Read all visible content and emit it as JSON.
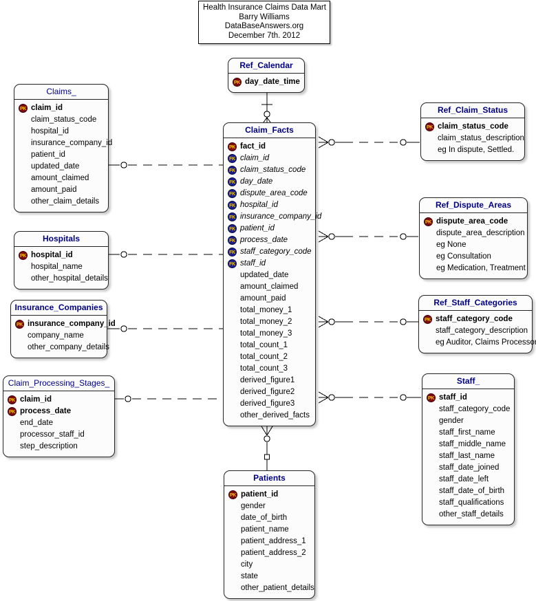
{
  "title_block": {
    "lines": [
      "Health Insurance Claims Data Mart",
      "Barry Williams",
      "DataBaseAnswers.org",
      "December 7th. 2012"
    ]
  },
  "colors": {
    "entity_title": "#000080",
    "pk_badge": "#7d0b10",
    "fk_badge": "#1b1f8c",
    "badge_text": "#f2c200",
    "entity_fill": "#fcfcfc",
    "entity_border": "#222222",
    "connector": "#000000"
  },
  "icon_labels": {
    "pk": "PK",
    "fk": "FK"
  },
  "entities": [
    {
      "id": "ref_calendar",
      "name": "Ref_Calendar",
      "title_bold": true,
      "columns": [
        {
          "name": "day_date_time",
          "key": "pk",
          "bold": true,
          "italic": false
        }
      ]
    },
    {
      "id": "claims",
      "name": "Claims_",
      "title_bold": false,
      "columns": [
        {
          "name": "claim_id",
          "key": "pk",
          "bold": true,
          "italic": false
        },
        {
          "name": "claim_status_code",
          "key": "none",
          "bold": false,
          "italic": false
        },
        {
          "name": "hospital_id",
          "key": "none",
          "bold": false,
          "italic": false
        },
        {
          "name": "insurance_company_id",
          "key": "none",
          "bold": false,
          "italic": false
        },
        {
          "name": "patient_id",
          "key": "none",
          "bold": false,
          "italic": false
        },
        {
          "name": "updated_date",
          "key": "none",
          "bold": false,
          "italic": false
        },
        {
          "name": "amount_claimed",
          "key": "none",
          "bold": false,
          "italic": false
        },
        {
          "name": "amount_paid",
          "key": "none",
          "bold": false,
          "italic": false
        },
        {
          "name": "other_claim_details",
          "key": "none",
          "bold": false,
          "italic": false
        }
      ]
    },
    {
      "id": "hospitals",
      "name": "Hospitals",
      "title_bold": true,
      "columns": [
        {
          "name": "hospital_id",
          "key": "pk",
          "bold": true,
          "italic": false
        },
        {
          "name": "hospital_name",
          "key": "none",
          "bold": false,
          "italic": false
        },
        {
          "name": "other_hospital_details",
          "key": "none",
          "bold": false,
          "italic": false
        }
      ]
    },
    {
      "id": "insurance_companies",
      "name": "Insurance_Companies",
      "title_bold": true,
      "columns": [
        {
          "name": "insurance_company_id",
          "key": "pk",
          "bold": true,
          "italic": false
        },
        {
          "name": "company_name",
          "key": "none",
          "bold": false,
          "italic": false
        },
        {
          "name": "other_company_details",
          "key": "none",
          "bold": false,
          "italic": false
        }
      ]
    },
    {
      "id": "claim_processing_stages",
      "name": "Claim_Processing_Stages_",
      "title_bold": false,
      "columns": [
        {
          "name": "claim_id",
          "key": "pk",
          "bold": true,
          "italic": false
        },
        {
          "name": "process_date",
          "key": "pk",
          "bold": true,
          "italic": false
        },
        {
          "name": "end_date",
          "key": "none",
          "bold": false,
          "italic": false
        },
        {
          "name": "processor_staff_id",
          "key": "none",
          "bold": false,
          "italic": false
        },
        {
          "name": "step_description",
          "key": "none",
          "bold": false,
          "italic": false
        }
      ]
    },
    {
      "id": "claim_facts",
      "name": "Claim_Facts",
      "title_bold": true,
      "columns": [
        {
          "name": "fact_id",
          "key": "pk",
          "bold": true,
          "italic": false
        },
        {
          "name": "claim_id",
          "key": "fk",
          "bold": false,
          "italic": true
        },
        {
          "name": "claim_status_code",
          "key": "fk",
          "bold": false,
          "italic": true
        },
        {
          "name": "day_date",
          "key": "fk",
          "bold": false,
          "italic": true
        },
        {
          "name": "dispute_area_code",
          "key": "fk",
          "bold": false,
          "italic": true
        },
        {
          "name": "hospital_id",
          "key": "fk",
          "bold": false,
          "italic": true
        },
        {
          "name": "insurance_company_id",
          "key": "fk",
          "bold": false,
          "italic": true
        },
        {
          "name": "patient_id",
          "key": "fk",
          "bold": false,
          "italic": true
        },
        {
          "name": "process_date",
          "key": "fk",
          "bold": false,
          "italic": true
        },
        {
          "name": "staff_category_code",
          "key": "fk",
          "bold": false,
          "italic": true
        },
        {
          "name": "staff_id",
          "key": "fk",
          "bold": false,
          "italic": true
        },
        {
          "name": "updated_date",
          "key": "none",
          "bold": false,
          "italic": false
        },
        {
          "name": "amount_claimed",
          "key": "none",
          "bold": false,
          "italic": false
        },
        {
          "name": "amount_paid",
          "key": "none",
          "bold": false,
          "italic": false
        },
        {
          "name": "total_money_1",
          "key": "none",
          "bold": false,
          "italic": false
        },
        {
          "name": "total_money_2",
          "key": "none",
          "bold": false,
          "italic": false
        },
        {
          "name": "total_money_3",
          "key": "none",
          "bold": false,
          "italic": false
        },
        {
          "name": "total_count_1",
          "key": "none",
          "bold": false,
          "italic": false
        },
        {
          "name": "total_count_2",
          "key": "none",
          "bold": false,
          "italic": false
        },
        {
          "name": "total_count_3",
          "key": "none",
          "bold": false,
          "italic": false
        },
        {
          "name": "derived_figure1",
          "key": "none",
          "bold": false,
          "italic": false
        },
        {
          "name": "derived_figure2",
          "key": "none",
          "bold": false,
          "italic": false
        },
        {
          "name": "derived_figure3",
          "key": "none",
          "bold": false,
          "italic": false
        },
        {
          "name": "other_derived_facts",
          "key": "none",
          "bold": false,
          "italic": false
        }
      ]
    },
    {
      "id": "patients",
      "name": "Patients",
      "title_bold": true,
      "columns": [
        {
          "name": "patient_id",
          "key": "pk",
          "bold": true,
          "italic": false
        },
        {
          "name": "gender",
          "key": "none",
          "bold": false,
          "italic": false
        },
        {
          "name": "date_of_birth",
          "key": "none",
          "bold": false,
          "italic": false
        },
        {
          "name": "patient_name",
          "key": "none",
          "bold": false,
          "italic": false
        },
        {
          "name": "patient_address_1",
          "key": "none",
          "bold": false,
          "italic": false
        },
        {
          "name": "patient_address_2",
          "key": "none",
          "bold": false,
          "italic": false
        },
        {
          "name": "city",
          "key": "none",
          "bold": false,
          "italic": false
        },
        {
          "name": "state",
          "key": "none",
          "bold": false,
          "italic": false
        },
        {
          "name": "other_patient_details",
          "key": "none",
          "bold": false,
          "italic": false
        }
      ]
    },
    {
      "id": "ref_claim_status",
      "name": "Ref_Claim_Status",
      "title_bold": true,
      "columns": [
        {
          "name": "claim_status_code",
          "key": "pk",
          "bold": true,
          "italic": false
        },
        {
          "name": "claim_status_description",
          "key": "none",
          "bold": false,
          "italic": false
        },
        {
          "name": "eg In dispute, Settled.",
          "key": "none",
          "bold": false,
          "italic": false
        }
      ]
    },
    {
      "id": "ref_dispute_areas",
      "name": "Ref_Dispute_Areas",
      "title_bold": true,
      "columns": [
        {
          "name": "dispute_area_code",
          "key": "pk",
          "bold": true,
          "italic": false
        },
        {
          "name": "dispute_area_description",
          "key": "none",
          "bold": false,
          "italic": false
        },
        {
          "name": "eg None",
          "key": "none",
          "bold": false,
          "italic": false
        },
        {
          "name": "eg Consultation",
          "key": "none",
          "bold": false,
          "italic": false
        },
        {
          "name": "eg Medication, Treatment",
          "key": "none",
          "bold": false,
          "italic": false
        }
      ]
    },
    {
      "id": "ref_staff_categories",
      "name": "Ref_Staff_Categories",
      "title_bold": true,
      "columns": [
        {
          "name": "staff_category_code",
          "key": "pk",
          "bold": true,
          "italic": false
        },
        {
          "name": "staff_category_description",
          "key": "none",
          "bold": false,
          "italic": false
        },
        {
          "name": "eg Auditor, Claims Processor",
          "key": "none",
          "bold": false,
          "italic": false
        }
      ]
    },
    {
      "id": "staff",
      "name": "Staff_",
      "title_bold": true,
      "columns": [
        {
          "name": "staff_id",
          "key": "pk",
          "bold": true,
          "italic": false
        },
        {
          "name": "staff_category_code",
          "key": "none",
          "bold": false,
          "italic": false
        },
        {
          "name": "gender",
          "key": "none",
          "bold": false,
          "italic": false
        },
        {
          "name": "staff_first_name",
          "key": "none",
          "bold": false,
          "italic": false
        },
        {
          "name": "staff_middle_name",
          "key": "none",
          "bold": false,
          "italic": false
        },
        {
          "name": "staff_last_name",
          "key": "none",
          "bold": false,
          "italic": false
        },
        {
          "name": "staff_date_joined",
          "key": "none",
          "bold": false,
          "italic": false
        },
        {
          "name": "staff_date_left",
          "key": "none",
          "bold": false,
          "italic": false
        },
        {
          "name": "staff_date_of_birth",
          "key": "none",
          "bold": false,
          "italic": false
        },
        {
          "name": "staff_qualifications",
          "key": "none",
          "bold": false,
          "italic": false
        },
        {
          "name": "other_staff_details",
          "key": "none",
          "bold": false,
          "italic": false
        }
      ]
    }
  ],
  "relationships": [
    {
      "id": "rel-claims-facts",
      "from": "claims",
      "to": "claim_facts"
    },
    {
      "id": "rel-hospitals-facts",
      "from": "hospitals",
      "to": "claim_facts"
    },
    {
      "id": "rel-insurance-facts",
      "from": "insurance_companies",
      "to": "claim_facts"
    },
    {
      "id": "rel-stages-facts",
      "from": "claim_processing_stages",
      "to": "claim_facts"
    },
    {
      "id": "rel-calendar-facts",
      "from": "ref_calendar",
      "to": "claim_facts"
    },
    {
      "id": "rel-patients-facts",
      "from": "patients",
      "to": "claim_facts"
    },
    {
      "id": "rel-facts-claimstatus",
      "from": "claim_facts",
      "to": "ref_claim_status"
    },
    {
      "id": "rel-facts-disputeareas",
      "from": "claim_facts",
      "to": "ref_dispute_areas"
    },
    {
      "id": "rel-facts-staffcategories",
      "from": "claim_facts",
      "to": "ref_staff_categories"
    },
    {
      "id": "rel-facts-staff",
      "from": "claim_facts",
      "to": "staff"
    }
  ]
}
